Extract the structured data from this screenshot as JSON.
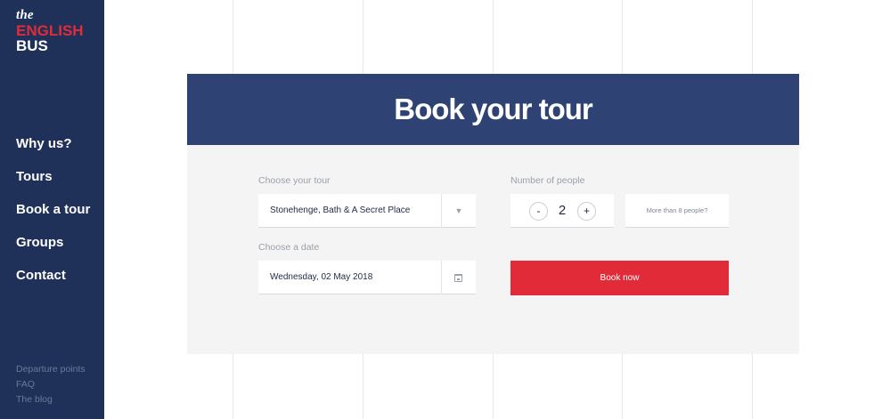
{
  "brand": {
    "logo_the": "the",
    "logo_english": "ENGLISH",
    "logo_bus": "BUS",
    "colors": {
      "navy": "#1f3158",
      "panel_navy": "#2e4373",
      "red": "#e12b39"
    }
  },
  "nav": {
    "items": [
      {
        "label": "Why us?"
      },
      {
        "label": "Tours"
      },
      {
        "label": "Book a tour"
      },
      {
        "label": "Groups"
      },
      {
        "label": "Contact"
      }
    ]
  },
  "footer_links": [
    {
      "label": "Departure points"
    },
    {
      "label": "FAQ"
    },
    {
      "label": "The blog"
    }
  ],
  "booking": {
    "title": "Book your tour",
    "tour_label": "Choose your tour",
    "tour_value": "Stonehenge, Bath & A Secret Place",
    "tour_icon": "caret-down-icon",
    "date_label": "Choose a date",
    "date_value": "Wednesday, 02 May 2018",
    "date_icon": "calendar-icon",
    "people_label": "Number of people",
    "people_minus": "-",
    "people_count": "2",
    "people_plus": "+",
    "more_people": "More than 8 people?",
    "book_button": "Book now"
  }
}
